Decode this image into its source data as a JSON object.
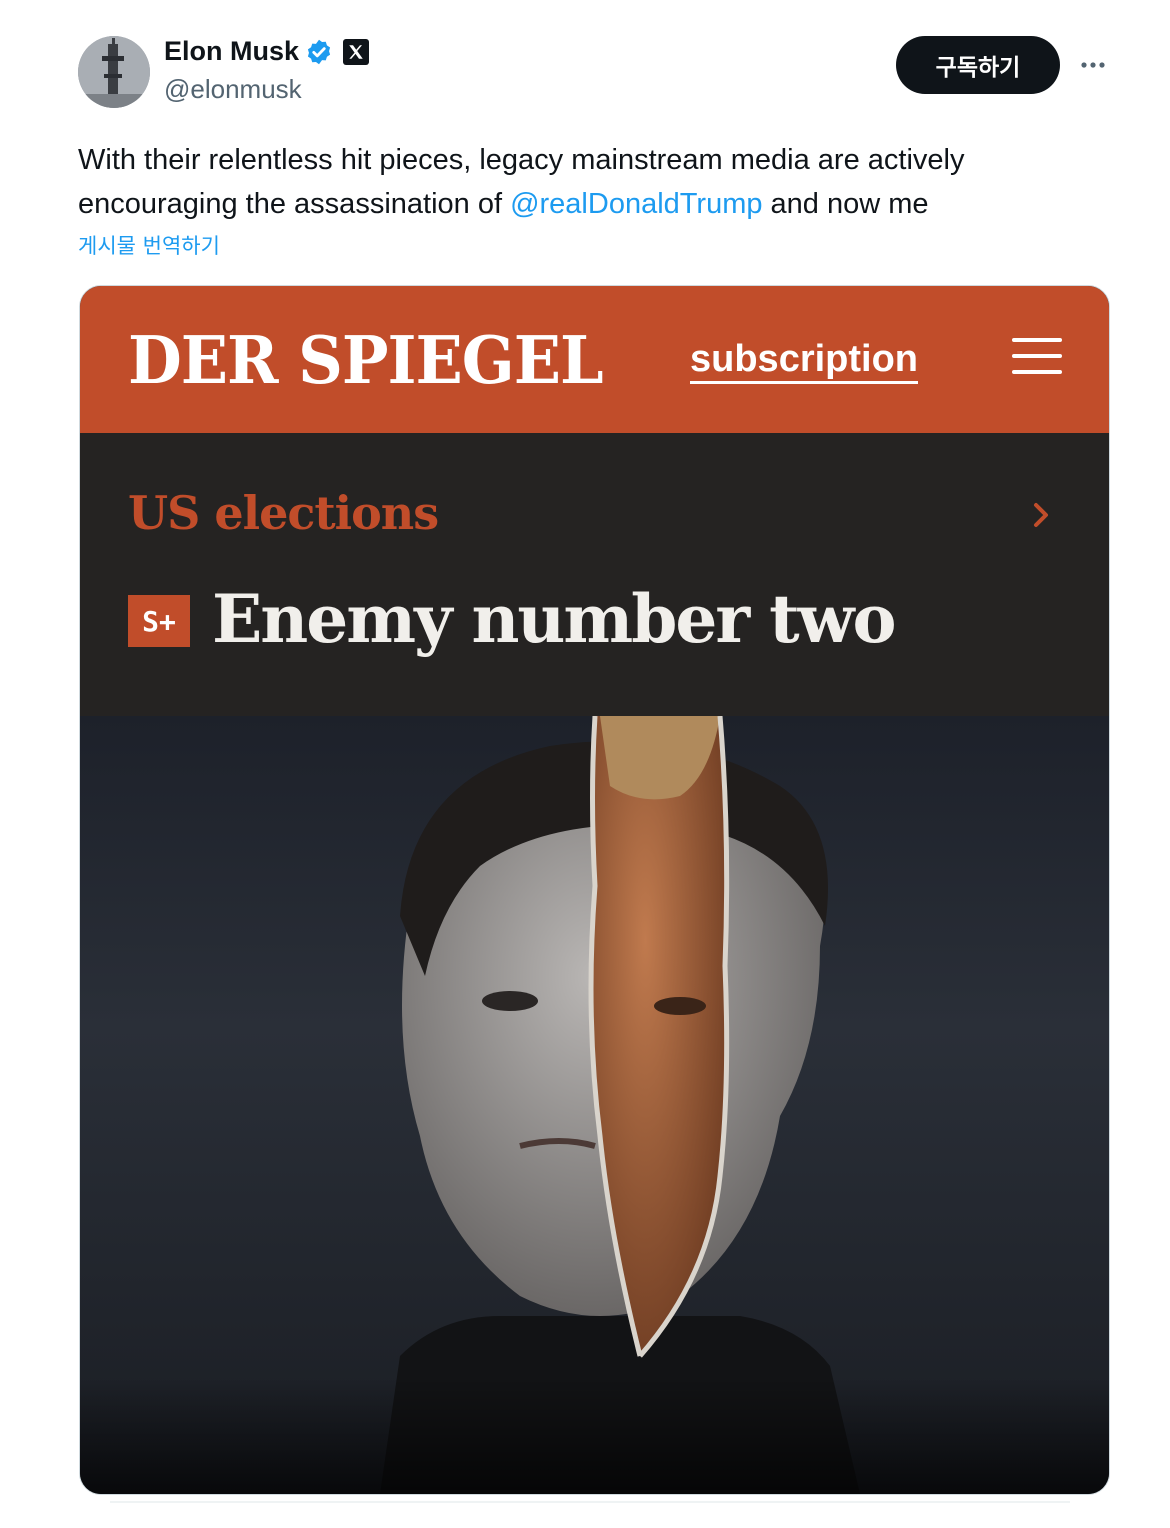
{
  "author": {
    "name": "Elon Musk",
    "handle": "@elonmusk",
    "verified_icon": "verified-badge-icon",
    "affiliate_icon": "x-logo-icon"
  },
  "actions": {
    "subscribe_label": "구독하기",
    "more_icon": "more-icon"
  },
  "tweet": {
    "text_before": "With their relentless hit pieces, legacy mainstream media are actively encouraging the assassination of ",
    "mention": "@realDonaldTrump",
    "text_after": " and now me",
    "translate_label": "게시물 번역하기"
  },
  "media": {
    "logo": "DER SPIEGEL",
    "subscription_label": "subscription",
    "menu_icon": "hamburger-menu-icon",
    "section_label": "US elections",
    "chevron_icon": "chevron-right-icon",
    "badge": "S+",
    "headline": "Enemy number two",
    "colors": {
      "brand": "#c14d2a",
      "dark": "#252322",
      "accent_link": "#1d9bf0"
    }
  }
}
